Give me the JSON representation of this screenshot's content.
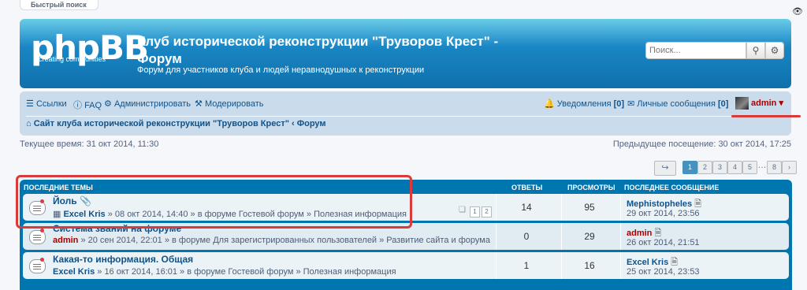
{
  "quick_search_tab": "Быстрый поиск",
  "header": {
    "logo": "phpBB",
    "logo_sub": "creating communities",
    "title": "Клуб исторической реконструкции \"Труворов Крест\" - Форум",
    "description": "Форум для участников клуба и людей неравнодушных к реконструкции",
    "search_placeholder": "Поиск...",
    "search_icon": "magnifier-icon",
    "advanced_icon": "gear-icon"
  },
  "nav": {
    "links": "Ссылки",
    "faq": "FAQ",
    "admin": "Администрировать",
    "moderate": "Модерировать",
    "notifications": "Уведомления",
    "notifications_count": "[0]",
    "messages": "Личные сообщения",
    "messages_count": "[0]",
    "user": "admin",
    "breadcrumb_site": "Сайт клуба исторической реконструкции \"Труворов Крест\"",
    "breadcrumb_sep": "‹",
    "breadcrumb_forum": "Форум"
  },
  "time": {
    "current": "Текущее время: 31 окт 2014, 11:30",
    "previous": "Предыдущее посещение: 30 окт 2014, 17:25"
  },
  "pager": {
    "pages": [
      "1",
      "2",
      "3",
      "4",
      "5",
      "…",
      "8",
      "›"
    ],
    "active": "1"
  },
  "table": {
    "headers": {
      "topics": "Последние темы",
      "replies": "Ответы",
      "views": "Просмотры",
      "last": "Последнее сообщение"
    },
    "rows": [
      {
        "title": "Йоль",
        "author": "Excel Kris",
        "meta": "» 08 окт 2014, 14:40 » в форуме Гостевой форум » Полезная информация",
        "mini_pages": [
          "1",
          "2"
        ],
        "replies": "14",
        "views": "95",
        "last_author": "Mephistopheles",
        "last_time": "29 окт 2014, 23:56"
      },
      {
        "title": "Система званий на форуме",
        "author": "admin",
        "meta": "» 20 сен 2014, 22:01 » в форуме Для зарегистрированных пользователей » Развитие сайта и форума",
        "replies": "0",
        "views": "29",
        "last_author": "admin",
        "last_time": "26 окт 2014, 21:51"
      },
      {
        "title": "Какая-то информация. Общая",
        "author": "Excel Kris",
        "meta": "» 16 окт 2014, 16:01 » в форуме Гостевой форум » Полезная информация",
        "replies": "1",
        "views": "16",
        "last_author": "Excel Kris",
        "last_time": "25 окт 2014, 23:53"
      }
    ]
  }
}
